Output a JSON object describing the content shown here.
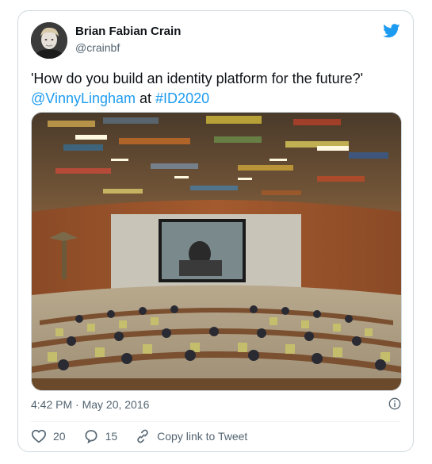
{
  "tweet": {
    "author_name": "Brian Fabian Crain",
    "author_handle": "@crainbf",
    "text_quote": "'How do you build an identity platform for the future?'",
    "mention": "@VinnyLingham",
    "connector": " at ",
    "hashtag": "#ID2020",
    "timestamp": "4:42 PM · May 20, 2016",
    "likes": "20",
    "replies": "15",
    "copy_link_label": "Copy link to Tweet"
  },
  "icons": {
    "brand": "twitter-bird-icon",
    "info": "info-icon",
    "like": "heart-icon",
    "reply": "reply-bubble-icon",
    "copy": "link-icon"
  },
  "colors": {
    "accent": "#1d9bf0",
    "text": "#0f1419",
    "muted": "#536471",
    "border": "#cfd9de"
  }
}
